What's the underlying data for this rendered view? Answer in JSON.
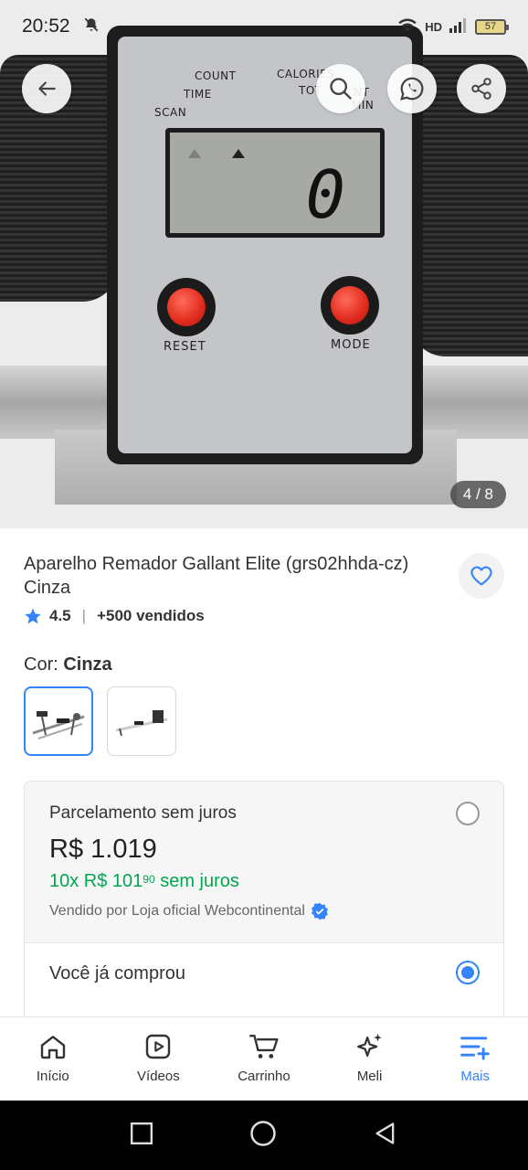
{
  "status_bar": {
    "time": "20:52",
    "network": "HD",
    "battery": "57"
  },
  "gallery": {
    "counter": "4 / 8",
    "console": {
      "labels": {
        "scan": "SCAN",
        "time": "TIME",
        "count": "COUNT",
        "calories": "CALORIES",
        "total": "TOT",
        "ant": "NT",
        "min": "MIN"
      },
      "display_value": "0",
      "reset_label": "RESET",
      "mode_label": "MODE"
    }
  },
  "product": {
    "title": "Aparelho Remador Gallant Elite (grs02hhda-cz) Cinza",
    "rating": "4.5",
    "sold": "+500 vendidos",
    "color_prefix": "Cor: ",
    "color_value": "Cinza"
  },
  "payment": {
    "title": "Parcelamento sem juros",
    "price": "R$ 1.019",
    "installment_prefix": "10x R$ 101",
    "installment_cents": "90",
    "installment_suffix": " sem juros",
    "seller": "Vendido por Loja oficial Webcontinental",
    "bought_label": "Você já comprou"
  },
  "bottom_nav": [
    {
      "label": "Início",
      "icon": "home-icon"
    },
    {
      "label": "Vídeos",
      "icon": "video-icon"
    },
    {
      "label": "Carrinho",
      "icon": "cart-icon"
    },
    {
      "label": "Meli",
      "icon": "sparkle-icon"
    },
    {
      "label": "Mais",
      "icon": "menu-plus-icon"
    }
  ],
  "colors": {
    "accent": "#3483fa",
    "green": "#00a650",
    "led": "#e02a1c"
  }
}
